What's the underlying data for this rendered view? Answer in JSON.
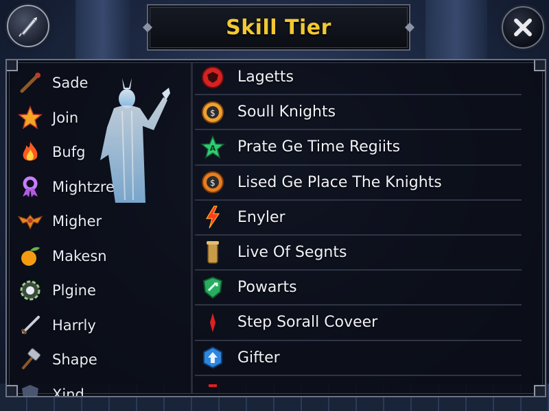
{
  "header": {
    "title": "Skill Tier"
  },
  "buttons": {
    "menu_icon": "quill-icon",
    "close_icon": "close-x-icon"
  },
  "colors": {
    "title_gold": "#f2c832",
    "panel_bg": "#0a0d16",
    "frame": "#6b7386"
  },
  "left_list": [
    {
      "label": "Sade",
      "icon": "staff-icon"
    },
    {
      "label": "Join",
      "icon": "star-icon"
    },
    {
      "label": "Bufg",
      "icon": "flame-icon"
    },
    {
      "label": "Mightzre",
      "icon": "ribbon-icon"
    },
    {
      "label": "Migher",
      "icon": "winged-crest-icon"
    },
    {
      "label": "Makesn",
      "icon": "orange-fruit-icon"
    },
    {
      "label": "Plgine",
      "icon": "gear-emblem-icon"
    },
    {
      "label": "Harrly",
      "icon": "sword-icon"
    },
    {
      "label": "Shape",
      "icon": "hammer-icon"
    },
    {
      "label": "Xind",
      "icon": "shield-icon"
    }
  ],
  "right_list": [
    {
      "label": "Lagetts",
      "icon": "red-emblem-icon"
    },
    {
      "label": "Soull Knights",
      "icon": "gold-shield-icon"
    },
    {
      "label": "Prate Ge Time Regiits",
      "icon": "green-star-icon"
    },
    {
      "label": "Lised Ge Place The Knights",
      "icon": "orange-shield-icon"
    },
    {
      "label": "Enyler",
      "icon": "lightning-icon"
    },
    {
      "label": "Live Of Segnts",
      "icon": "scroll-icon"
    },
    {
      "label": "Powarts",
      "icon": "green-badge-icon"
    },
    {
      "label": "Step Sorall Coveer",
      "icon": "red-shard-icon"
    },
    {
      "label": "Gifter",
      "icon": "blue-gem-icon"
    },
    {
      "label": "",
      "icon": "red-partial-icon"
    }
  ]
}
